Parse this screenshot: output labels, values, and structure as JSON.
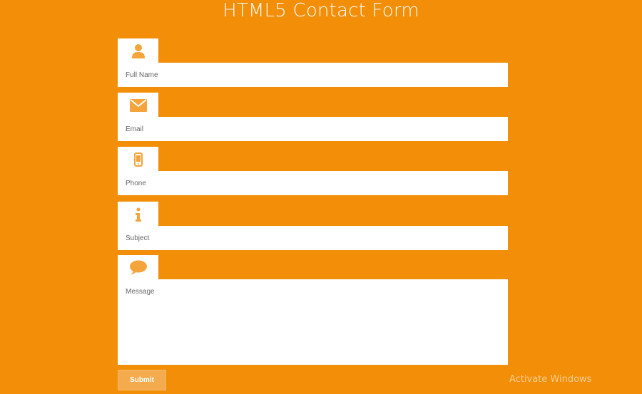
{
  "page": {
    "title": "HTML5 Contact Form",
    "background_color": "#f28e08",
    "accent_color": "#f4ab4e"
  },
  "form": {
    "fields": [
      {
        "id": "full_name",
        "icon": "person-icon",
        "placeholder": "Full Name",
        "value": ""
      },
      {
        "id": "email",
        "icon": "envelope-icon",
        "placeholder": "Email",
        "value": ""
      },
      {
        "id": "phone",
        "icon": "mobile-phone-icon",
        "placeholder": "Phone",
        "value": ""
      },
      {
        "id": "subject",
        "icon": "info-icon",
        "placeholder": "Subject",
        "value": ""
      },
      {
        "id": "message",
        "icon": "speech-bubble-icon",
        "placeholder": "Message",
        "value": ""
      }
    ],
    "submit_label": "Submit"
  },
  "watermark": {
    "line1": "Activate Windows"
  }
}
